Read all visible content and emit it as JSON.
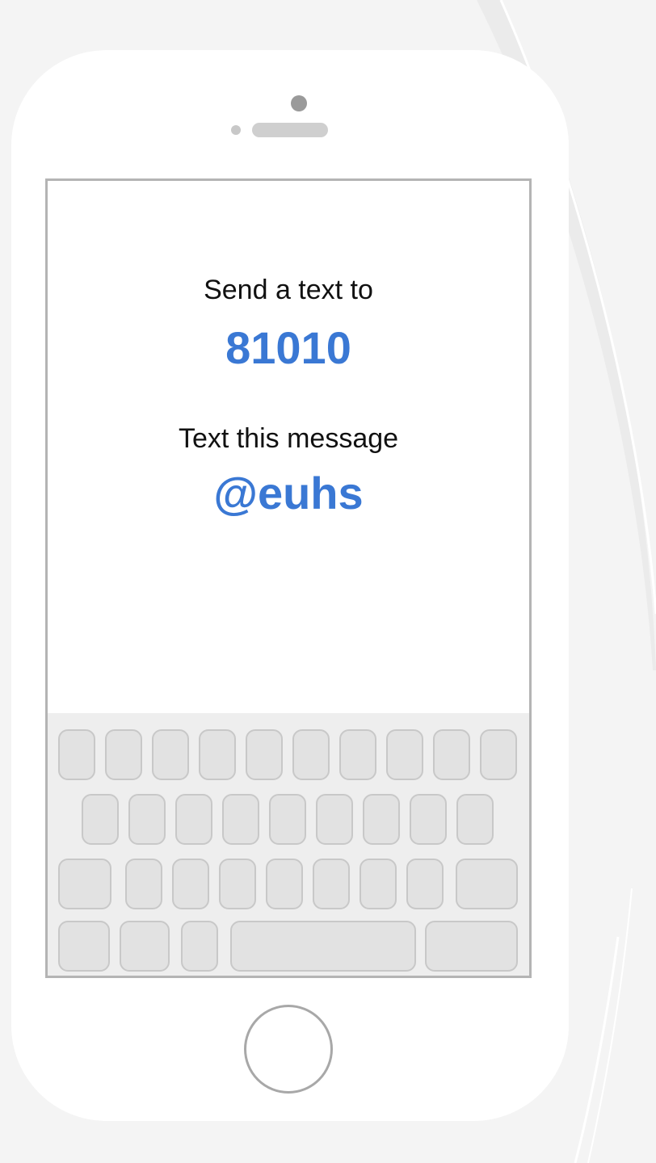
{
  "screen": {
    "send_label": "Send a text to",
    "number": "81010",
    "message_label": "Text this message",
    "message": "@euhs"
  },
  "keyboard": {
    "row_key_counts": [
      10,
      9,
      9,
      5
    ]
  },
  "colors": {
    "accent": "#3a78d4",
    "background": "#f4f4f4",
    "phone_body": "#ffffff",
    "key_fill": "#e2e2e2",
    "key_border": "#c8c8c8"
  }
}
